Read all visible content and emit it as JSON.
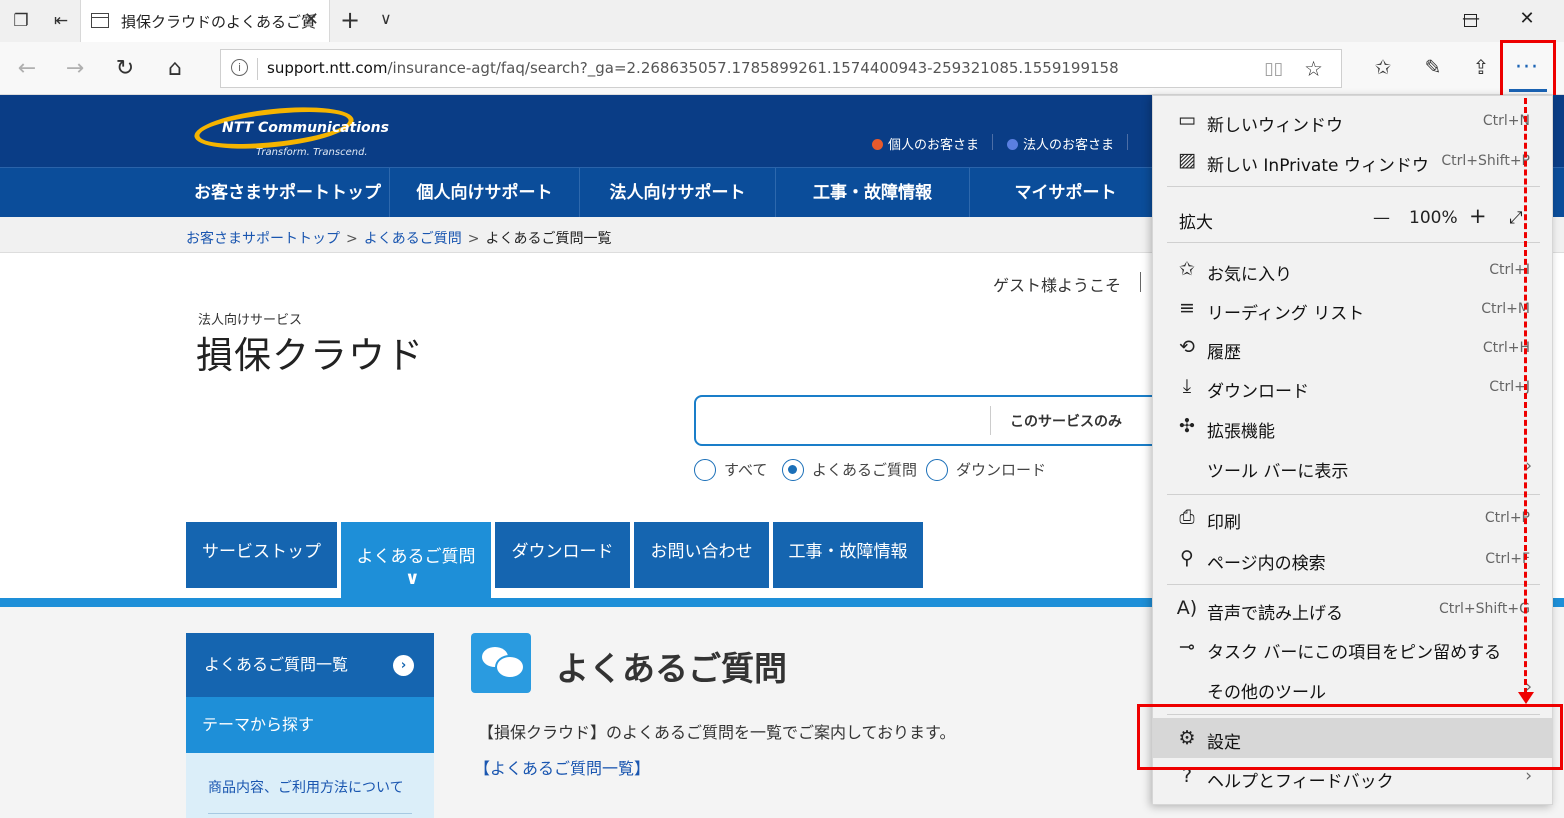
{
  "browser": {
    "tab_title": "損保クラウドのよくあるご質",
    "tab_close": "✕",
    "url_host": "support.ntt.com",
    "url_path": "/insurance-agt/faq/search?_ga=2.268635057.1785899261.1574400943-259321085.1559199158",
    "more_button": "···"
  },
  "site": {
    "logo_text": "NTT Communications",
    "logo_tagline": "Transform. Transcend.",
    "header_links": [
      {
        "label": "個人のお客さま",
        "color": "#e85a2c"
      },
      {
        "label": "法人のお客さま",
        "color": "#5a7fe0"
      }
    ],
    "global_nav": [
      "お客さまサポートトップ",
      "個人向けサポート",
      "法人向けサポート",
      "工事・故障情報",
      "マイサポート"
    ],
    "breadcrumb": [
      "お客さまサポートトップ",
      "よくあるご質問",
      "よくあるご質問一覧"
    ],
    "breadcrumb_sep": ">",
    "guest": "ゲスト様ようこそ",
    "service_sub": "法人向けサービス",
    "service_title": "損保クラウド",
    "search_scope": "このサービスのみ",
    "radios": [
      {
        "label": "すべて",
        "checked": false
      },
      {
        "label": "よくあるご質問",
        "checked": true
      },
      {
        "label": "ダウンロード",
        "checked": false
      }
    ],
    "service_tabs": [
      "サービストップ",
      "よくあるご質問",
      "ダウンロード",
      "お問い合わせ",
      "工事・故障情報"
    ],
    "sidebar": {
      "faq_list": "よくあるご質問一覧",
      "theme": "テーマから探す",
      "sub_item": "商品内容、ご利用方法について"
    },
    "faq_heading": "よくあるご質問",
    "faq_desc": "【損保クラウド】のよくあるご質問を一覧でご案内しております。",
    "faq_link": "【よくあるご質問一覧】"
  },
  "menu": {
    "items": [
      {
        "label": "新しいウィンドウ",
        "shortcut": "Ctrl+N"
      },
      {
        "label": "新しい InPrivate ウィンドウ",
        "shortcut": "Ctrl+Shift+P"
      },
      {
        "label": "拡大",
        "zoom_minus": "—",
        "zoom_value": "100%",
        "zoom_plus": "+"
      },
      {
        "label": "お気に入り",
        "shortcut": "Ctrl+I"
      },
      {
        "label": "リーディング リスト",
        "shortcut": "Ctrl+M"
      },
      {
        "label": "履歴",
        "shortcut": "Ctrl+H"
      },
      {
        "label": "ダウンロード",
        "shortcut": "Ctrl+J"
      },
      {
        "label": "拡張機能"
      },
      {
        "label": "ツール バーに表示"
      },
      {
        "label": "印刷",
        "shortcut": "Ctrl+P"
      },
      {
        "label": "ページ内の検索",
        "shortcut": "Ctrl+F"
      },
      {
        "label": "音声で読み上げる",
        "shortcut": "Ctrl+Shift+G"
      },
      {
        "label": "タスク バーにこの項目をピン留めする"
      },
      {
        "label": "その他のツール"
      },
      {
        "label": "設定"
      },
      {
        "label": "ヘルプとフィードバック"
      }
    ]
  },
  "annotation_color": "#e00000"
}
